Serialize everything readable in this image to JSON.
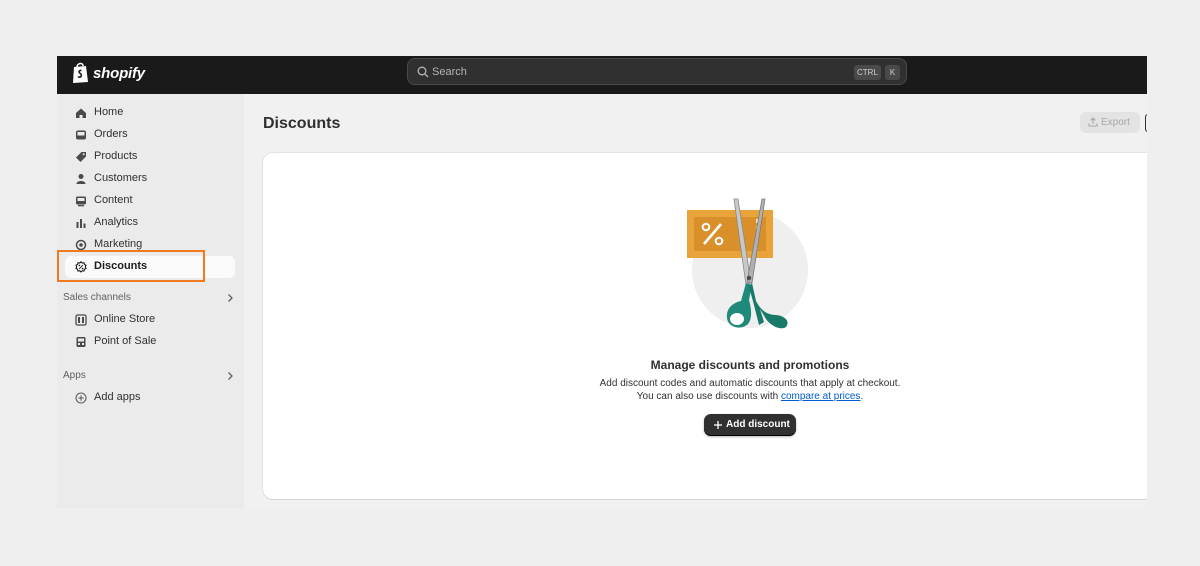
{
  "topbar": {
    "logo_text": "shopify",
    "search_placeholder": "Search",
    "shortcut_keys": [
      "CTRL",
      "K"
    ]
  },
  "sidebar": {
    "items": [
      {
        "label": "Home",
        "icon": "home-icon"
      },
      {
        "label": "Orders",
        "icon": "inbox-icon"
      },
      {
        "label": "Products",
        "icon": "tag-icon"
      },
      {
        "label": "Customers",
        "icon": "person-icon"
      },
      {
        "label": "Content",
        "icon": "content-icon"
      },
      {
        "label": "Analytics",
        "icon": "bar-chart-icon"
      },
      {
        "label": "Marketing",
        "icon": "target-icon"
      },
      {
        "label": "Discounts",
        "icon": "discount-icon",
        "active": true
      }
    ],
    "sales_channels": {
      "label": "Sales channels",
      "items": [
        {
          "label": "Online Store",
          "icon": "store-icon"
        },
        {
          "label": "Point of Sale",
          "icon": "pos-icon"
        }
      ]
    },
    "apps": {
      "label": "Apps",
      "items": [
        {
          "label": "Add apps",
          "icon": "plus-circle-icon"
        }
      ]
    }
  },
  "main": {
    "title": "Discounts",
    "export_label": "Export",
    "empty_state": {
      "title": "Manage discounts and promotions",
      "line1": "Add discount codes and automatic discounts that apply at checkout.",
      "line2_prefix": "You can also use discounts with ",
      "line2_link": "compare at prices",
      "line2_suffix": ".",
      "button_label": "Add discount"
    }
  },
  "colors": {
    "topbar": "#1a1a1a",
    "highlight": "#f07a1f",
    "primary_button": "#303030",
    "link": "#005bd3",
    "coupon": "#e8a33a",
    "scissors_handle": "#1f8a7a"
  }
}
